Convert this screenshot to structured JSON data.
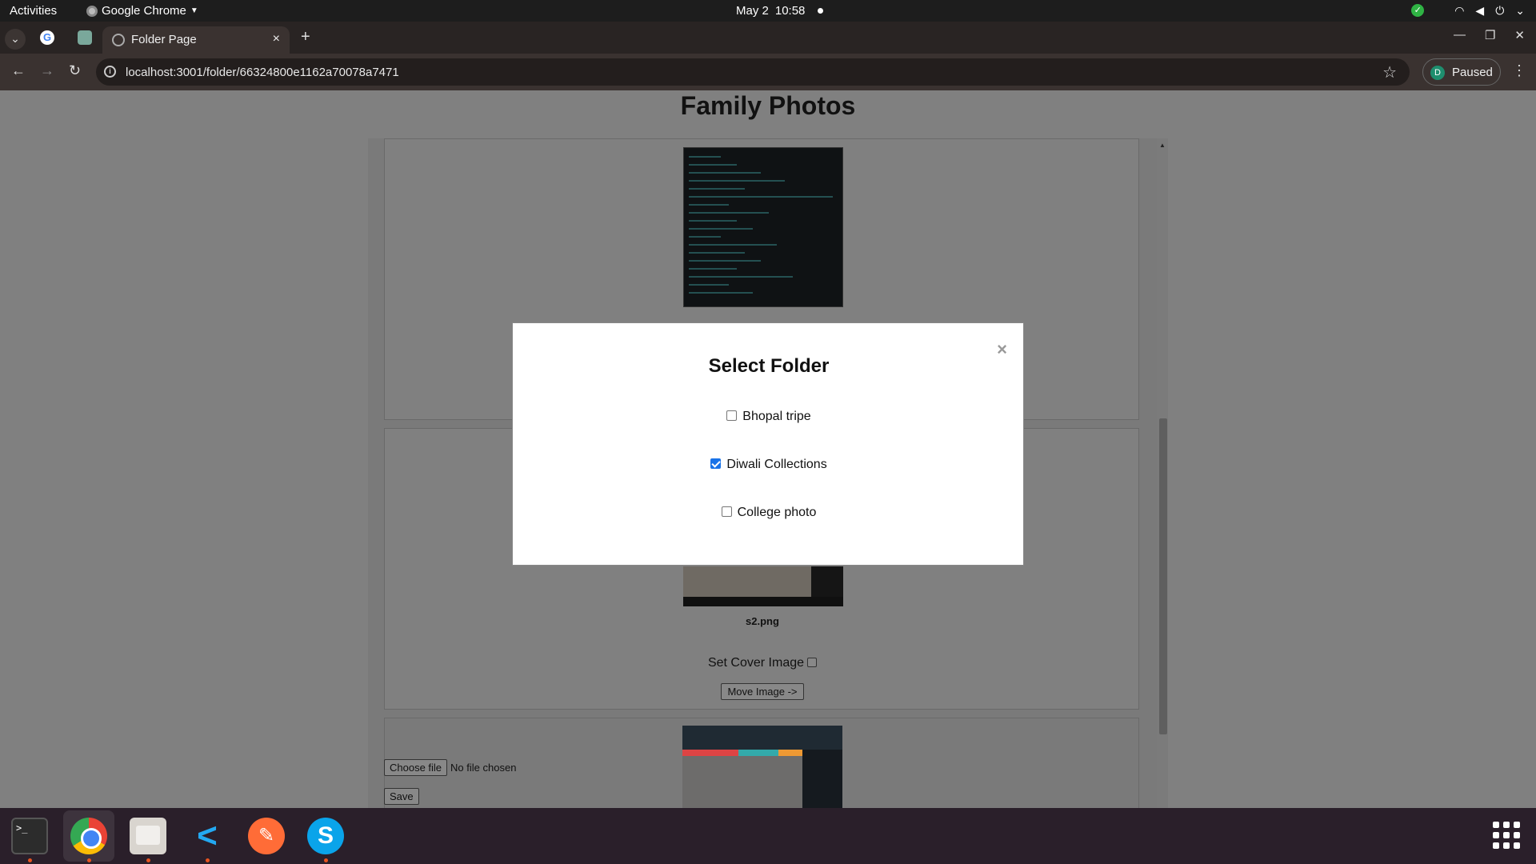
{
  "system": {
    "activities": "Activities",
    "app_name": "Google Chrome",
    "date": "May 2",
    "time": "10:58"
  },
  "browser": {
    "tab_title": "Folder Page",
    "tab_close": "×",
    "new_tab": "+",
    "url": "localhost:3001/folder/66324800e1162a70078a7471",
    "profile_initial": "D",
    "profile_status": "Paused"
  },
  "page": {
    "title": "Family Photos",
    "images": [
      {
        "filename": "s2.png",
        "set_cover_label": "Set Cover Image",
        "move_label": "Move Image ->"
      }
    ],
    "upload": {
      "choose_label": "Choose file",
      "status": "No file chosen",
      "save_label": "Save"
    }
  },
  "modal": {
    "title": "Select Folder",
    "close": "×",
    "options": [
      {
        "label": "Bhopal tripe",
        "checked": false
      },
      {
        "label": "Diwali Collections",
        "checked": true
      },
      {
        "label": "College photo",
        "checked": false
      }
    ]
  },
  "dock": {
    "apps": [
      "terminal-icon",
      "chrome-icon",
      "files-icon",
      "vscode-icon",
      "postman-icon",
      "skype-icon"
    ],
    "accent": "#e95420"
  },
  "colors": {
    "checkbox_accent": "#1a73e8",
    "overlay": "#808080"
  }
}
